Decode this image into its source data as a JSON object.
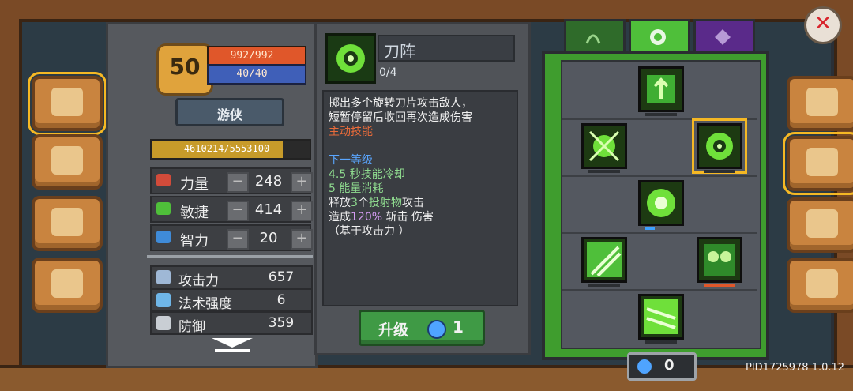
{
  "character": {
    "level": "50",
    "hp": "992/992",
    "mp": "40/40",
    "class_name": "游侠",
    "exp_text": "4610214/5553100",
    "exp_fraction": 0.83
  },
  "stats": [
    {
      "label": "力量",
      "value": "248",
      "icon": "fist-icon",
      "color": "#d24b3a"
    },
    {
      "label": "敏捷",
      "value": "414",
      "icon": "leaf-icon",
      "color": "#4fbf3a"
    },
    {
      "label": "智力",
      "value": "20",
      "icon": "book-icon",
      "color": "#3f8bd8"
    }
  ],
  "stat_controls": {
    "minus": "−",
    "plus": "+"
  },
  "attributes": [
    {
      "label": "攻击力",
      "value": "657",
      "icon": "sword-icon"
    },
    {
      "label": "法术强度",
      "value": "6",
      "icon": "wand-icon"
    },
    {
      "label": "防御",
      "value": "359",
      "icon": "shield-icon"
    }
  ],
  "skill": {
    "name": "刀阵",
    "level": "0/4",
    "desc_lines": [
      "掷出多个旋转刀片攻击敌人，",
      "短暂停留后收回再次造成伤害",
      "主动技能"
    ],
    "next_level_header": "下一等级",
    "cooldown": "4.5 秒技能冷却",
    "energy": "5 能量消耗",
    "release_prefix": "释放",
    "release_count": "3",
    "release_mid": "个",
    "release_word": "投射物",
    "release_suffix": "攻击",
    "dmg_prefix": "造成",
    "dmg_pct": "120%",
    "dmg_suffix": "斩击 伤害",
    "based_on": "（基于攻击力 ）"
  },
  "upgrade": {
    "label": "升级",
    "cost": "1"
  },
  "tabs": [
    {
      "name": "bow-icon",
      "active": false
    },
    {
      "name": "swirl-icon",
      "active": true
    },
    {
      "name": "emblem-icon",
      "active": false
    }
  ],
  "gem_count": "0",
  "version": "PID1725978 1.0.12",
  "close_glyph": "✕",
  "left_menu": [
    "book-icon",
    "treasure-icon",
    "gear-cluster-icon",
    "steering-icon"
  ],
  "right_menu": [
    "helmet-icon",
    "skills-icon",
    "compass-icon",
    "settings-icon"
  ],
  "colors": {
    "accent_green": "#3f9d2e",
    "select_gold": "#f5b824"
  }
}
